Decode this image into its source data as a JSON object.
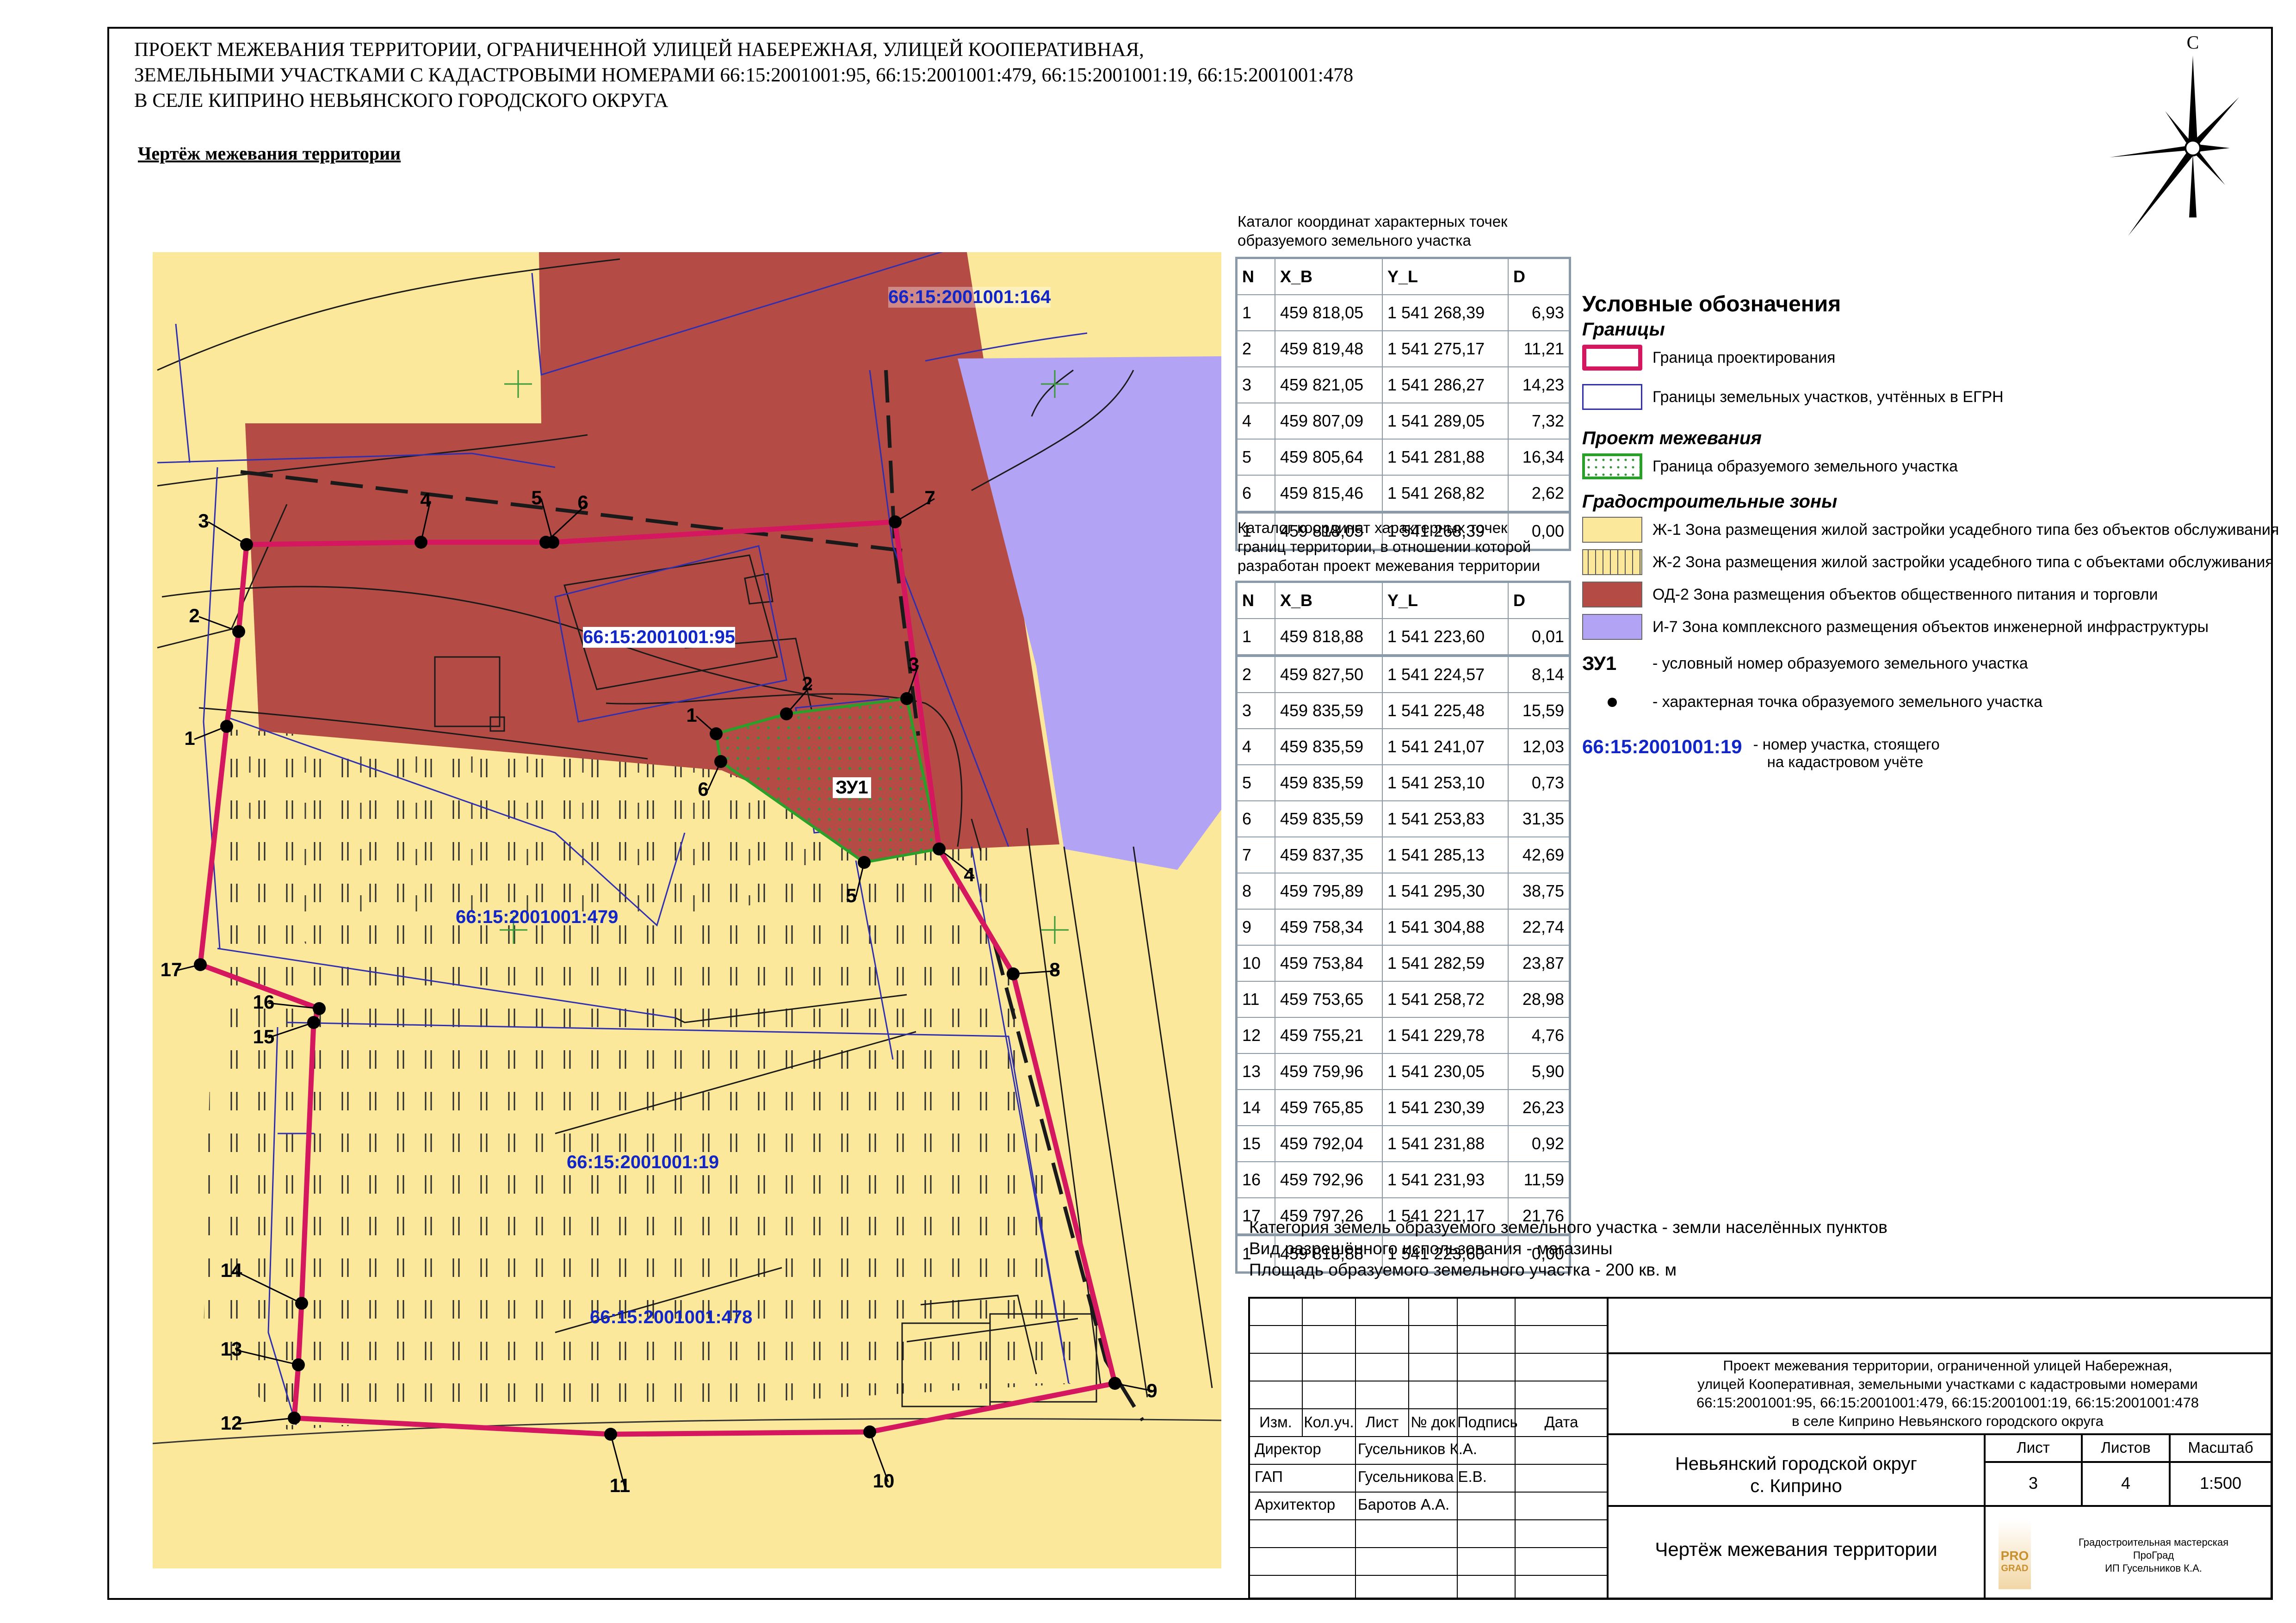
{
  "header": {
    "title_lines": [
      "ПРОЕКТ МЕЖЕВАНИЯ ТЕРРИТОРИИ, ОГРАНИЧЕННОЙ УЛИЦЕЙ НАБЕРЕЖНАЯ, УЛИЦЕЙ КООПЕРАТИВНАЯ,",
      "ЗЕМЕЛЬНЫМИ УЧАСТКАМИ С КАДАСТРОВЫМИ НОМЕРАМИ 66:15:2001001:95, 66:15:2001001:479, 66:15:2001001:19, 66:15:2001001:478",
      "В СЕЛЕ КИПРИНО НЕВЬЯНСКОГО ГОРОДСКОГО ОКРУГА"
    ],
    "subtitle": "Чертёж межевания территории"
  },
  "compass": {
    "north_label": "С"
  },
  "map": {
    "parcel_labels": {
      "p164": "66:15:2001001:164",
      "p95": "66:15:2001001:95",
      "p479": "66:15:2001001:479",
      "p19": "66:15:2001001:19",
      "p478": "66:15:2001001:478"
    },
    "zu1_label": "ЗУ1",
    "boundary_point_labels": [
      "1",
      "2",
      "3",
      "4",
      "5",
      "6",
      "7",
      "8",
      "9",
      "10",
      "11",
      "12",
      "13",
      "14",
      "15",
      "16",
      "17"
    ],
    "zu_point_labels": [
      "1",
      "2",
      "3",
      "4",
      "5",
      "6"
    ]
  },
  "catalog_zu": {
    "title_lines": [
      "Каталог координат характерных точек",
      "образуемого земельного участка"
    ],
    "columns": [
      "N",
      "X_B",
      "Y_L",
      "D"
    ],
    "rows": [
      [
        "1",
        "459 818,05",
        "1 541 268,39",
        "6,93"
      ],
      [
        "2",
        "459 819,48",
        "1 541 275,17",
        "11,21"
      ],
      [
        "3",
        "459 821,05",
        "1 541 286,27",
        "14,23"
      ],
      [
        "4",
        "459 807,09",
        "1 541 289,05",
        "7,32"
      ],
      [
        "5",
        "459 805,64",
        "1 541 281,88",
        "16,34"
      ],
      [
        "6",
        "459 815,46",
        "1 541 268,82",
        "2,62"
      ],
      [
        "1",
        "459 818,05",
        "1 541 268,39",
        "0,00"
      ]
    ]
  },
  "catalog_territory": {
    "title_lines": [
      "Каталог координат характерных точек",
      "границ территории, в отношении которой",
      "разработан проект межевания территории"
    ],
    "columns": [
      "N",
      "X_B",
      "Y_L",
      "D"
    ],
    "rows": [
      [
        "1",
        "459 818,88",
        "1 541 223,60",
        "0,01"
      ],
      [
        "2",
        "459 827,50",
        "1 541 224,57",
        "8,14"
      ],
      [
        "3",
        "459 835,59",
        "1 541 225,48",
        "15,59"
      ],
      [
        "4",
        "459 835,59",
        "1 541 241,07",
        "12,03"
      ],
      [
        "5",
        "459 835,59",
        "1 541 253,10",
        "0,73"
      ],
      [
        "6",
        "459 835,59",
        "1 541 253,83",
        "31,35"
      ],
      [
        "7",
        "459 837,35",
        "1 541 285,13",
        "42,69"
      ],
      [
        "8",
        "459 795,89",
        "1 541 295,30",
        "38,75"
      ],
      [
        "9",
        "459 758,34",
        "1 541 304,88",
        "22,74"
      ],
      [
        "10",
        "459 753,84",
        "1 541 282,59",
        "23,87"
      ],
      [
        "11",
        "459 753,65",
        "1 541 258,72",
        "28,98"
      ],
      [
        "12",
        "459 755,21",
        "1 541 229,78",
        "4,76"
      ],
      [
        "13",
        "459 759,96",
        "1 541 230,05",
        "5,90"
      ],
      [
        "14",
        "459 765,85",
        "1 541 230,39",
        "26,23"
      ],
      [
        "15",
        "459 792,04",
        "1 541 231,88",
        "0,92"
      ],
      [
        "16",
        "459 792,96",
        "1 541 231,93",
        "11,59"
      ],
      [
        "17",
        "459 797,26",
        "1 541 221,17",
        "21,76"
      ],
      [
        "1",
        "459 818,88",
        "1 541 223,60",
        "0,00"
      ]
    ]
  },
  "legend": {
    "title": "Условные обозначения",
    "sec_borders": "Границы",
    "border_project": "Граница проектирования",
    "border_egrn": "Границы земельных участков, учтённых в ЕГРН",
    "sec_project": "Проект межевания",
    "border_new": "Граница образуемого земельного участка",
    "sec_zones": "Градостроительные зоны",
    "zone_zh1": "Ж-1 Зона размещения жилой застройки усадебного типа без объектов обслуживания",
    "zone_zh2": "Ж-2 Зона размещения жилой застройки усадебного типа с объектами обслуживания",
    "zone_od2": "ОД-2 Зона размещения объектов общественного питания и торговли",
    "zone_i7": "И-7 Зона комплексного размещения объектов инженерной инфраструктуры",
    "zu_code": "ЗУ1",
    "zu_code_desc": "- условный номер образуемого земельного участка",
    "point_desc": "- характерная точка образуемого земельного участка",
    "cad_example": "66:15:2001001:19",
    "cad_desc_1": "- номер участка, стоящего",
    "cad_desc_2": "на кадастровом учёте",
    "colors": {
      "zh1": "#fbe89a",
      "od2": "#b54b45",
      "i7": "#b3a3f4",
      "project": "#d4175f",
      "egrn": "#2f2fb0",
      "new": "#2aa02a"
    }
  },
  "info": {
    "line1": "Категория земель образуемого земельного участка - земли населённых пунктов",
    "line2": "Вид разрешённого использования - магазины",
    "line3": "Площадь образуемого земельного участка - 200 кв. м"
  },
  "stamp": {
    "project_lines": [
      "Проект межевания территории, ограниченной улицей Набережная,",
      "улицей Кооперативная, земельными участками с кадастровыми номерами",
      "66:15:2001001:95, 66:15:2001001:479, 66:15:2001001:19, 66:15:2001001:478",
      "в селе Киприно Невьянского городского округа"
    ],
    "col_headers": [
      "Изм.",
      "Кол.уч.",
      "Лист",
      "№ док",
      "Подпись",
      "Дата"
    ],
    "roles": [
      {
        "role": "Директор",
        "name": "Гусельников К.А."
      },
      {
        "role": "ГАП",
        "name": "Гусельникова Е.В."
      },
      {
        "role": "Архитектор",
        "name": "Баротов А.А."
      }
    ],
    "location_1": "Невьянский городской округ",
    "location_2": "с. Киприно",
    "sheet_label": "Лист",
    "sheets_label": "Листов",
    "scale_label": "Масштаб",
    "sheet": "3",
    "sheets": "4",
    "scale": "1:500",
    "drawing_name": "Чертёж межевания территории",
    "logo_text_1": "PRO",
    "logo_text_2": "GRAD",
    "company_lines": [
      "Градостроительная мастерская",
      "ПроГрад",
      "ИП Гусельников К.А."
    ]
  }
}
